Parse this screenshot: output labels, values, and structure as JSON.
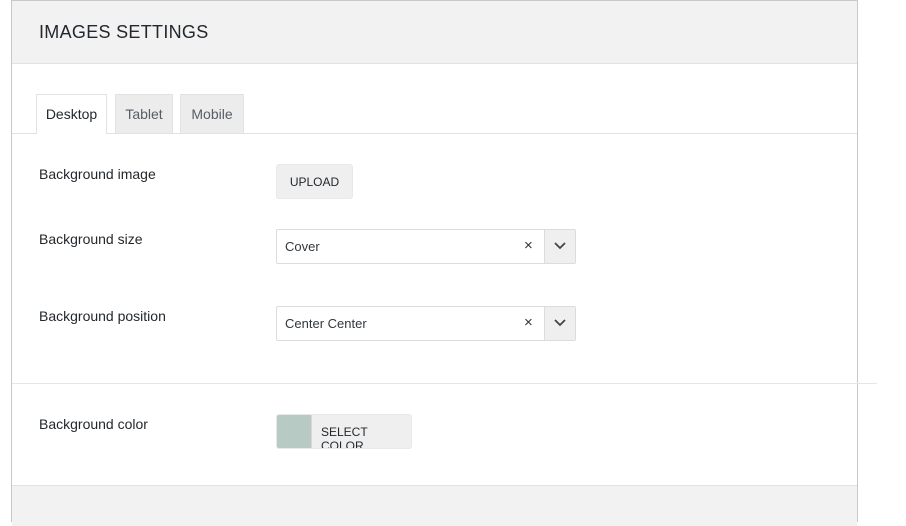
{
  "panel": {
    "title": "IMAGES SETTINGS"
  },
  "tabs": [
    {
      "label": "Desktop",
      "active": true
    },
    {
      "label": "Tablet",
      "active": false
    },
    {
      "label": "Mobile",
      "active": false
    }
  ],
  "fields": {
    "background_image": {
      "label": "Background image",
      "button_label": "UPLOAD"
    },
    "background_size": {
      "label": "Background size",
      "value": "Cover",
      "clear_glyph": "×"
    },
    "background_position": {
      "label": "Background position",
      "value": "Center Center",
      "clear_glyph": "×"
    },
    "background_color": {
      "label": "Background color",
      "button_label": "SELECT COLOR",
      "swatch_color": "#b7cbc4"
    }
  },
  "icons": {
    "select_arrow": "chevron-down-icon",
    "select_clear": "close-icon"
  }
}
